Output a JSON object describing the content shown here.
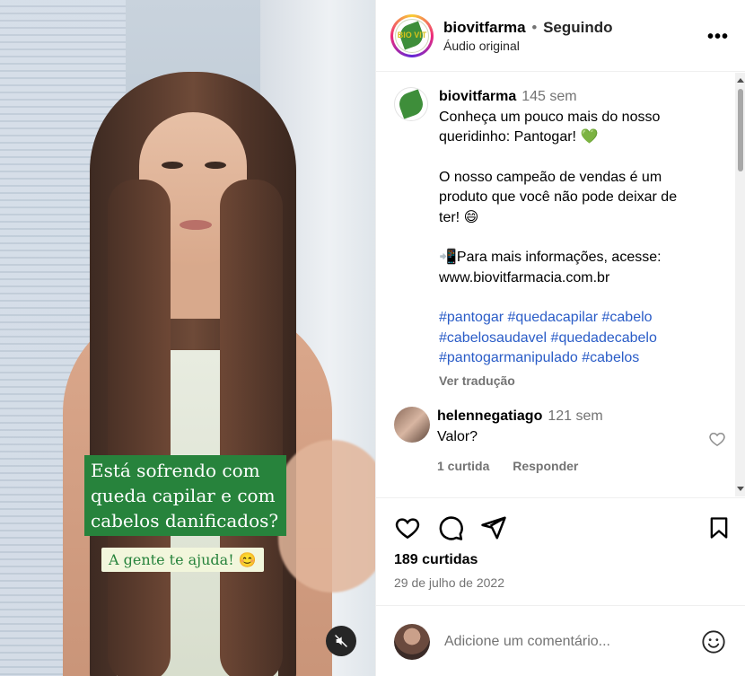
{
  "media": {
    "caption_lines": [
      "Está sofrendo com",
      "queda capilar e com",
      "cabelos danificados?"
    ],
    "caption_sub": "A gente te ajuda! 😊",
    "mute_icon": "speaker-muted-icon"
  },
  "header": {
    "username": "biovitfarma",
    "separator": "•",
    "follow_status": "Seguindo",
    "audio": "Áudio original",
    "more": "•••",
    "logo_text": "BIO VIT"
  },
  "post": {
    "username": "biovitfarma",
    "time": "145 sem",
    "line1": "Conheça um pouco mais do nosso queridinho: Pantogar! 💚",
    "line2": "O nosso campeão de vendas é um produto que você não pode deixar de ter! 😄",
    "line3": "📲Para mais informações, acesse: www.biovitfarmacia.com.br",
    "hashtags": [
      "#pantogar",
      "#quedacapilar",
      "#cabelo",
      "#cabelosaudavel",
      "#quedadecabelo",
      "#pantogarmanipulado",
      "#cabelos"
    ],
    "translate": "Ver tradução"
  },
  "comment": {
    "username": "helennegatiago",
    "time": "121 sem",
    "text": "Valor?",
    "likes": "1 curtida",
    "reply": "Responder"
  },
  "actions": {
    "likes": "189 curtidas",
    "date": "29 de julho de 2022"
  },
  "add_comment": {
    "placeholder": "Adicione um comentário..."
  }
}
